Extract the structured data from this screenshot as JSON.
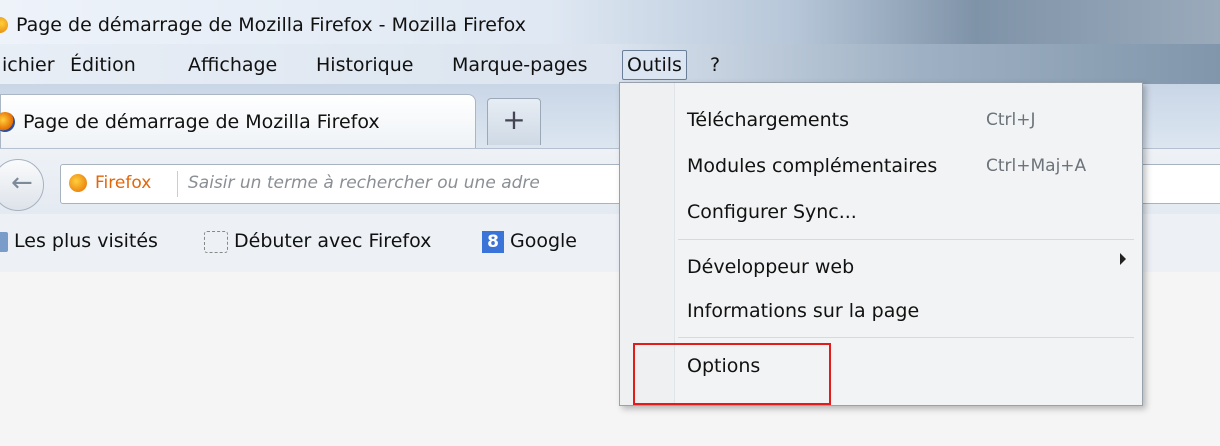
{
  "window": {
    "title": "Page de démarrage de Mozilla Firefox - Mozilla Firefox"
  },
  "menubar": {
    "items": [
      {
        "label": "ichier"
      },
      {
        "label": "Édition"
      },
      {
        "label": "Affichage"
      },
      {
        "label": "Historique"
      },
      {
        "label": "Marque-pages"
      },
      {
        "label": "Outils",
        "active": true
      },
      {
        "label": "?"
      }
    ]
  },
  "tabs": {
    "active_tab_label": "Page de démarrage de Mozilla Firefox",
    "new_tab_label": "+"
  },
  "navbar": {
    "identity_label": "Firefox",
    "url_placeholder": "Saisir un terme à rechercher ou une adre"
  },
  "bookmarks": {
    "items": [
      {
        "label": "Les plus visités",
        "icon": "folder-icon"
      },
      {
        "label": "Débuter avec Firefox",
        "icon": "dashed-page-icon"
      },
      {
        "label": "Google",
        "icon": "google-icon"
      }
    ]
  },
  "outils_menu": {
    "items": [
      {
        "label": "Téléchargements",
        "shortcut": "Ctrl+J"
      },
      {
        "label": "Modules complémentaires",
        "shortcut": "Ctrl+Maj+A"
      },
      {
        "label": "Configurer Sync...",
        "shortcut": ""
      },
      {
        "label": "Développeur web",
        "shortcut": "",
        "submenu": true
      },
      {
        "label": "Informations sur la page",
        "shortcut": ""
      },
      {
        "label": "Options",
        "shortcut": "",
        "highlighted": true
      }
    ]
  },
  "colors": {
    "highlight_border": "#e31b1b",
    "firefox_orange": "#e2660a"
  }
}
